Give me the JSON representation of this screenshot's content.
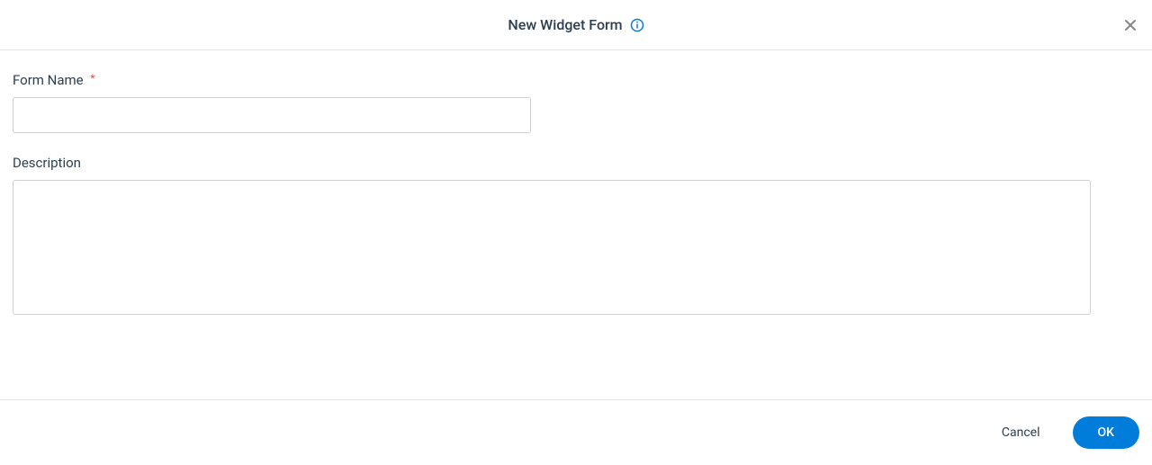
{
  "header": {
    "title": "New Widget Form"
  },
  "form": {
    "formName": {
      "label": "Form Name",
      "value": "",
      "required": true
    },
    "description": {
      "label": "Description",
      "value": ""
    }
  },
  "footer": {
    "cancel": "Cancel",
    "ok": "OK"
  },
  "required_marker": "*"
}
